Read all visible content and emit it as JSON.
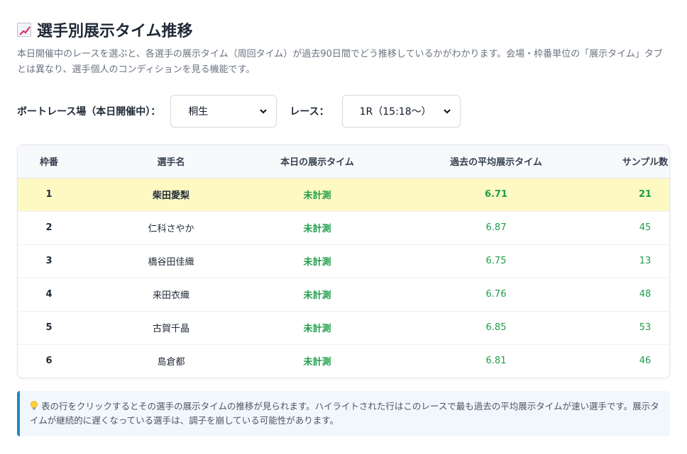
{
  "header": {
    "title": "選手別展示タイム推移",
    "icon": "chart-increasing-icon",
    "description": "本日開催中のレースを選ぶと、各選手の展示タイム（周回タイム）が過去90日間でどう推移しているかがわかります。会場・枠番単位の「展示タイム」タブとは異なり、選手個人のコンディションを見る機能です。"
  },
  "controls": {
    "venue_label": "ボートレース場（本日開催中）：",
    "venue_selected": "桐生",
    "race_label": "レース：",
    "race_selected": "1R（15:18〜）"
  },
  "table": {
    "columns": [
      "枠番",
      "選手名",
      "本日の展示タイム",
      "過去の平均展示タイム",
      "サンプル数"
    ],
    "rows": [
      {
        "frame": "1",
        "name": "柴田愛梨",
        "today": "未計測",
        "avg": "6.71",
        "samples": "21"
      },
      {
        "frame": "2",
        "name": "仁科さやか",
        "today": "未計測",
        "avg": "6.87",
        "samples": "45"
      },
      {
        "frame": "3",
        "name": "橋谷田佳織",
        "today": "未計測",
        "avg": "6.75",
        "samples": "13"
      },
      {
        "frame": "4",
        "name": "来田衣織",
        "today": "未計測",
        "avg": "6.76",
        "samples": "48"
      },
      {
        "frame": "5",
        "name": "古賀千晶",
        "today": "未計測",
        "avg": "6.85",
        "samples": "53"
      },
      {
        "frame": "6",
        "name": "島倉都",
        "today": "未計測",
        "avg": "6.81",
        "samples": "46"
      }
    ],
    "highlight_row": 0
  },
  "note": {
    "icon": "lightbulb-icon",
    "text": "表の行をクリックするとその選手の展示タイムの推移が見られます。ハイライトされた行はこのレースで最も過去の平均展示タイムが速い選手です。展示タイムが継続的に遅くなっている選手は、調子を崩している可能性があります。"
  },
  "colors": {
    "highlight": "#fef9c3",
    "accent_green": "#1f9e4a",
    "note_border": "#1e88c8"
  }
}
